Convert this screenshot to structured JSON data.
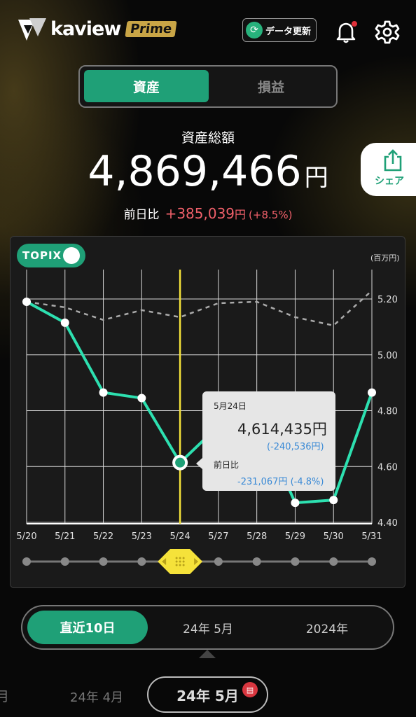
{
  "header": {
    "logo_text": "kaview",
    "logo_badge": "Prime",
    "refresh_label": "データ更新",
    "notification_dot_color": "#e0303a"
  },
  "tabs": [
    {
      "label": "資産",
      "active": true
    },
    {
      "label": "損益",
      "active": false
    }
  ],
  "summary": {
    "total_label": "資産総額",
    "total_value": "4,869,466",
    "currency": "円",
    "diff_label": "前日比",
    "diff_value": "+385,039",
    "diff_unit": "円",
    "diff_pct": "(+8.5%)"
  },
  "share": {
    "label": "シェア"
  },
  "chart_panel": {
    "topix_label": "TOPIX",
    "topix_on": true,
    "unit_label": "(百万円)"
  },
  "tooltip": {
    "date": "5月24日",
    "value": "4,614,435円",
    "change_small": "(-240,536円)",
    "prev_label": "前日比",
    "prev_value": "-231,067円",
    "prev_pct": "(-4.8%)"
  },
  "chart_data": {
    "type": "line",
    "categories": [
      "5/20",
      "5/21",
      "5/22",
      "5/23",
      "5/24",
      "5/27",
      "5/28",
      "5/29",
      "5/30",
      "5/31"
    ],
    "series": [
      {
        "values": [
          5.19,
          5.115,
          4.865,
          4.845,
          4.614,
          4.745,
          4.78,
          4.47,
          4.48,
          4.865
        ],
        "color": "#2de0b0"
      },
      {
        "values": [
          5.19,
          5.17,
          5.125,
          5.16,
          5.135,
          5.185,
          5.19,
          5.135,
          5.105,
          5.23
        ],
        "color": "#aaaaaa",
        "style": "dashed"
      }
    ],
    "y_ticks": [
      "5.20",
      "5.00",
      "4.80",
      "4.60",
      "4.40"
    ],
    "ylim": [
      4.4,
      5.2
    ],
    "selected_index": 4,
    "grid": true
  },
  "colors": {
    "accent": "#1fa077",
    "negative": "#f0606a",
    "highlight": "#f5e23a",
    "tooltip_blue": "#3a8ad6"
  },
  "period": {
    "options": [
      "直近10日",
      "24年 5月",
      "2024年"
    ],
    "active_index": 0
  },
  "months": {
    "prev2": "月",
    "prev": "24年 4月",
    "current": "24年 5月"
  }
}
